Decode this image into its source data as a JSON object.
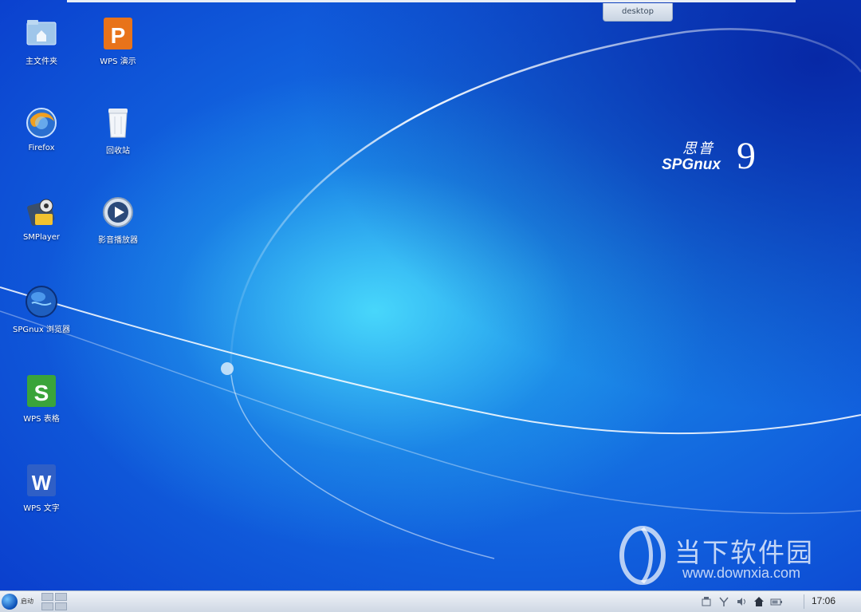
{
  "window": {
    "desktop_tab": "desktop"
  },
  "brand": {
    "cn": "思普",
    "name": "SPGnux",
    "version": "9"
  },
  "desktop_icons": [
    {
      "label": "主文件夹",
      "icon": "home-folder-icon"
    },
    {
      "label": "WPS 演示",
      "icon": "wps-presentation-icon"
    },
    {
      "label": "Firefox",
      "icon": "firefox-icon"
    },
    {
      "label": "回收站",
      "icon": "trash-icon"
    },
    {
      "label": "SMPlayer",
      "icon": "smplayer-icon"
    },
    {
      "label": "影音播放器",
      "icon": "media-player-icon"
    },
    {
      "label": "SPGnux 浏览器",
      "icon": "browser-globe-icon"
    },
    {
      "label": "WPS 表格",
      "icon": "wps-spreadsheet-icon"
    },
    {
      "label": "WPS 文字",
      "icon": "wps-writer-icon"
    }
  ],
  "watermark": {
    "cn": "当下软件园",
    "url": "www.downxia.com"
  },
  "taskbar": {
    "start_label": "启动",
    "tray_icons": [
      "network-icon",
      "input-method-icon",
      "volume-icon",
      "home-icon",
      "battery-icon"
    ],
    "clock": "17:06"
  },
  "colors": {
    "desktop_blue": "#1160dd",
    "glow_cyan": "#50e6ff",
    "taskbar": "#dfe6ef"
  }
}
